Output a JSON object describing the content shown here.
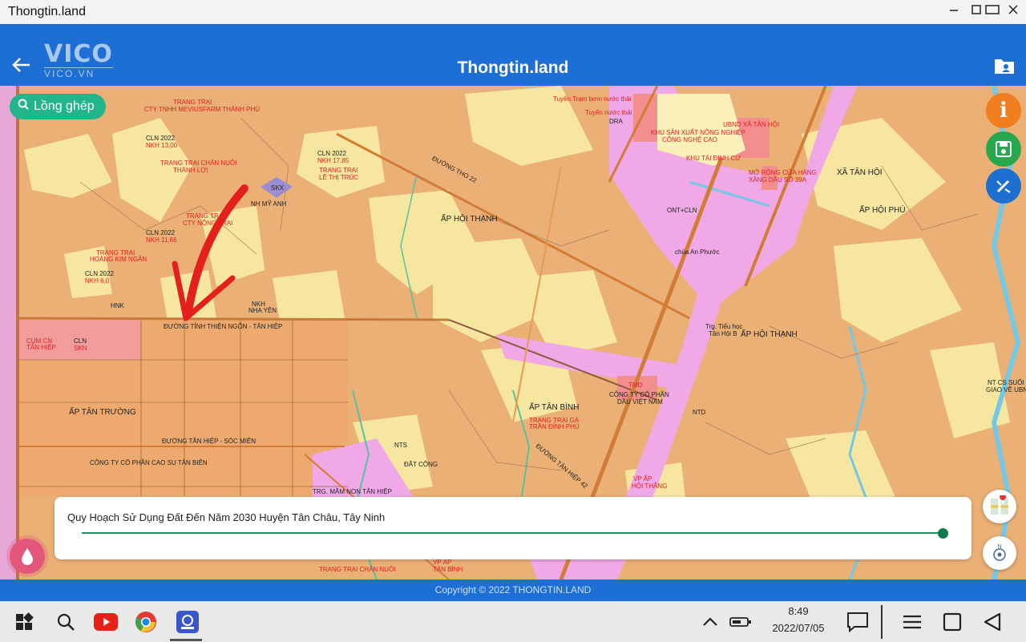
{
  "window": {
    "title": "Thongtin.land"
  },
  "app": {
    "logo_main": "VICO",
    "logo_sub": "VICO.VN",
    "title": "Thongtin.land"
  },
  "search": {
    "label": "Lồng ghép"
  },
  "panel": {
    "title": "Quy Hoạch Sử Dụng Đất Đến Năm 2030 Huyện Tân Châu, Tây Ninh",
    "opacity": 1.0
  },
  "footer": {
    "text": "Copyright © 2022 THONGTIN.LAND"
  },
  "taskbar": {
    "time": "8:49",
    "date": "2022/07/05"
  },
  "colors": {
    "appbar": "#1d6fd6",
    "accent_green": "#23b58a",
    "info_orange": "#f07d1e",
    "save_green": "#27a84f",
    "edit_blue": "#1e6fd0"
  },
  "icons": [
    "back-arrow-icon",
    "folder-icon",
    "search-icon",
    "info-icon",
    "save-icon",
    "edit-icon",
    "map-layer-icon",
    "compass-icon",
    "drop-icon",
    "start-icon",
    "search-icon",
    "youtube-icon",
    "chrome-icon",
    "app-icon",
    "chevron-up-icon",
    "battery-icon",
    "message-icon",
    "menu-icon",
    "square-icon",
    "back-triangle-icon"
  ],
  "map": {
    "labels": [
      {
        "text": "TRANG TRẠI",
        "red": true
      },
      {
        "text": "CTY TNHH MEVIUSFARM THÀNH PHÚ",
        "red": true
      },
      {
        "text": "CLN 2022",
        "red": false
      },
      {
        "text": "NKH 13,00",
        "red": true
      },
      {
        "text": "TRANG TRẠI CHĂN NUÔI",
        "red": true
      },
      {
        "text": "THÀNH LỢI",
        "red": true
      },
      {
        "text": "CLN 2022",
        "red": false
      },
      {
        "text": "NKH 17,85",
        "red": true
      },
      {
        "text": "TRANG TRẠI",
        "red": true
      },
      {
        "text": "LÊ THỊ TRÚC",
        "red": true
      },
      {
        "text": "SKX",
        "red": false
      },
      {
        "text": "NH MỸ ANH",
        "red": false
      },
      {
        "text": "CLN 2022",
        "red": false
      },
      {
        "text": "NKH 11,66",
        "red": true
      },
      {
        "text": "TRANG TRẠI",
        "red": true
      },
      {
        "text": "CTY NÔNG TRẠI",
        "red": true
      },
      {
        "text": "TRANG TRẠI",
        "red": true
      },
      {
        "text": "HOÀNG KIM NGÂN",
        "red": true
      },
      {
        "text": "CLN 2022",
        "red": false
      },
      {
        "text": "NKH 6,0",
        "red": true
      },
      {
        "text": "HNK",
        "red": false
      },
      {
        "text": "NKH",
        "red": false
      },
      {
        "text": "NHA YÊN",
        "red": false
      },
      {
        "text": "ĐƯỜNG TỈNH THIỆN NGÔN - TÂN HIỆP",
        "red": false
      },
      {
        "text": "CỤM CN",
        "red": true
      },
      {
        "text": "TÂN HIỆP",
        "red": true
      },
      {
        "text": "CLN",
        "red": false
      },
      {
        "text": "SKN",
        "red": true
      },
      {
        "text": "ẤP TÂN TRƯỜNG",
        "red": false
      },
      {
        "text": "ĐƯỜNG TÂN HIỆP - SÓC MIÊN",
        "red": false
      },
      {
        "text": "CÔNG TY CỔ PHẦN CAO SU TÂN BIÊN",
        "red": false
      },
      {
        "text": "ĐƯỜNG THO 22",
        "red": false
      },
      {
        "text": "ẤP HỘI THẠNH",
        "red": false
      },
      {
        "text": "Tuyến Trạm bơm nước thải",
        "red": true
      },
      {
        "text": "Tuyến nước thải",
        "red": true
      },
      {
        "text": "DRA",
        "red": false
      },
      {
        "text": "KHU SẢN XUẤT NÔNG NGHIỆP",
        "red": true
      },
      {
        "text": "CÔNG NGHỆ CAO",
        "red": true
      },
      {
        "text": "KHU TÁI ĐỊNH CƯ",
        "red": true
      },
      {
        "text": "UBND XÃ TÂN HỘI",
        "red": true
      },
      {
        "text": "MỞ RỘNG CỬA HÀNG",
        "red": true
      },
      {
        "text": "XĂNG DẦU SỐ 39A",
        "red": true
      },
      {
        "text": "XÃ TÂN HỘI",
        "red": false
      },
      {
        "text": "ẤP HỘI PHÚ",
        "red": false
      },
      {
        "text": "chùa An Phước",
        "red": false
      },
      {
        "text": "ONT+CLN",
        "red": false
      },
      {
        "text": "Trg. Tiểu học",
        "red": false
      },
      {
        "text": "Tân Hội B",
        "red": false
      },
      {
        "text": "ẤP HỘI THẠNH",
        "red": false
      },
      {
        "text": "TMD",
        "red": true
      },
      {
        "text": "CÔNG TY CỔ PHẦN",
        "red": false
      },
      {
        "text": "DẦU VIỆT NAM",
        "red": false
      },
      {
        "text": "ẤP TÂN BÌNH",
        "red": false
      },
      {
        "text": "TRANG TRẠI GÀ",
        "red": true
      },
      {
        "text": "TRẦN ĐÌNH PHÚ",
        "red": true
      },
      {
        "text": "ĐƯỜNG TÂN HIỆP 42",
        "red": false
      },
      {
        "text": "NTD",
        "red": false
      },
      {
        "text": "NTS",
        "red": false
      },
      {
        "text": "ĐẤT CÔNG",
        "red": false
      },
      {
        "text": "TRG. MẦM NON TÂN HIỆP",
        "red": false
      },
      {
        "text": "VP ẤP",
        "red": true
      },
      {
        "text": "HỘI THẮNG",
        "red": true
      },
      {
        "text": "NT CS SUỐI DÂY",
        "red": false
      },
      {
        "text": "GIAO VỀ UBND HUYỆN",
        "red": false
      },
      {
        "text": "TRANG TRẠI CHĂN NUÔI",
        "red": true
      },
      {
        "text": "VP ẤP",
        "red": true
      },
      {
        "text": "TÂN BÌNH",
        "red": true
      }
    ]
  }
}
